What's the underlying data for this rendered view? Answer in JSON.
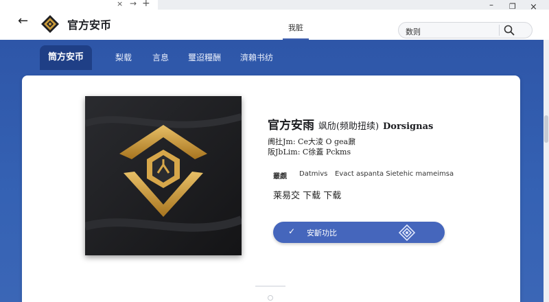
{
  "window": {
    "tab_close": "×",
    "nav_arrow": "→",
    "new_tab": "+",
    "minimize": "–",
    "maximize": "❐",
    "close": "×"
  },
  "header": {
    "back": "←",
    "app_title": "官方安币",
    "center_tab": "我脏",
    "search_value": "数则"
  },
  "nav": {
    "items": [
      {
        "label": "筒方安币",
        "active": true
      },
      {
        "label": "梨载"
      },
      {
        "label": "言息"
      },
      {
        "label": "璽迢糧酬"
      },
      {
        "label": "濟賴书纺"
      }
    ]
  },
  "product": {
    "title": "官方安雨",
    "title_sub": "飒劤(频助扭续)",
    "title_en": "Dorsignas",
    "meta_line1": "阓扗Jm:  Ce大淩 O gea鼐",
    "meta_line2": "阪JbLim:  C徐蓋 Pckms",
    "info_a": "叢覷",
    "info_b": "Datmivs",
    "info_c": "Evact aspanta Sietehic mameimsa",
    "download_text": "莱易交 下载  下载",
    "install_check": "✓",
    "install_label": "安齗功比"
  },
  "colors": {
    "band_blue": "#3562b4",
    "nav_active": "#1f3f86",
    "button_blue": "#4566bc",
    "gold": "#c99a3a"
  }
}
